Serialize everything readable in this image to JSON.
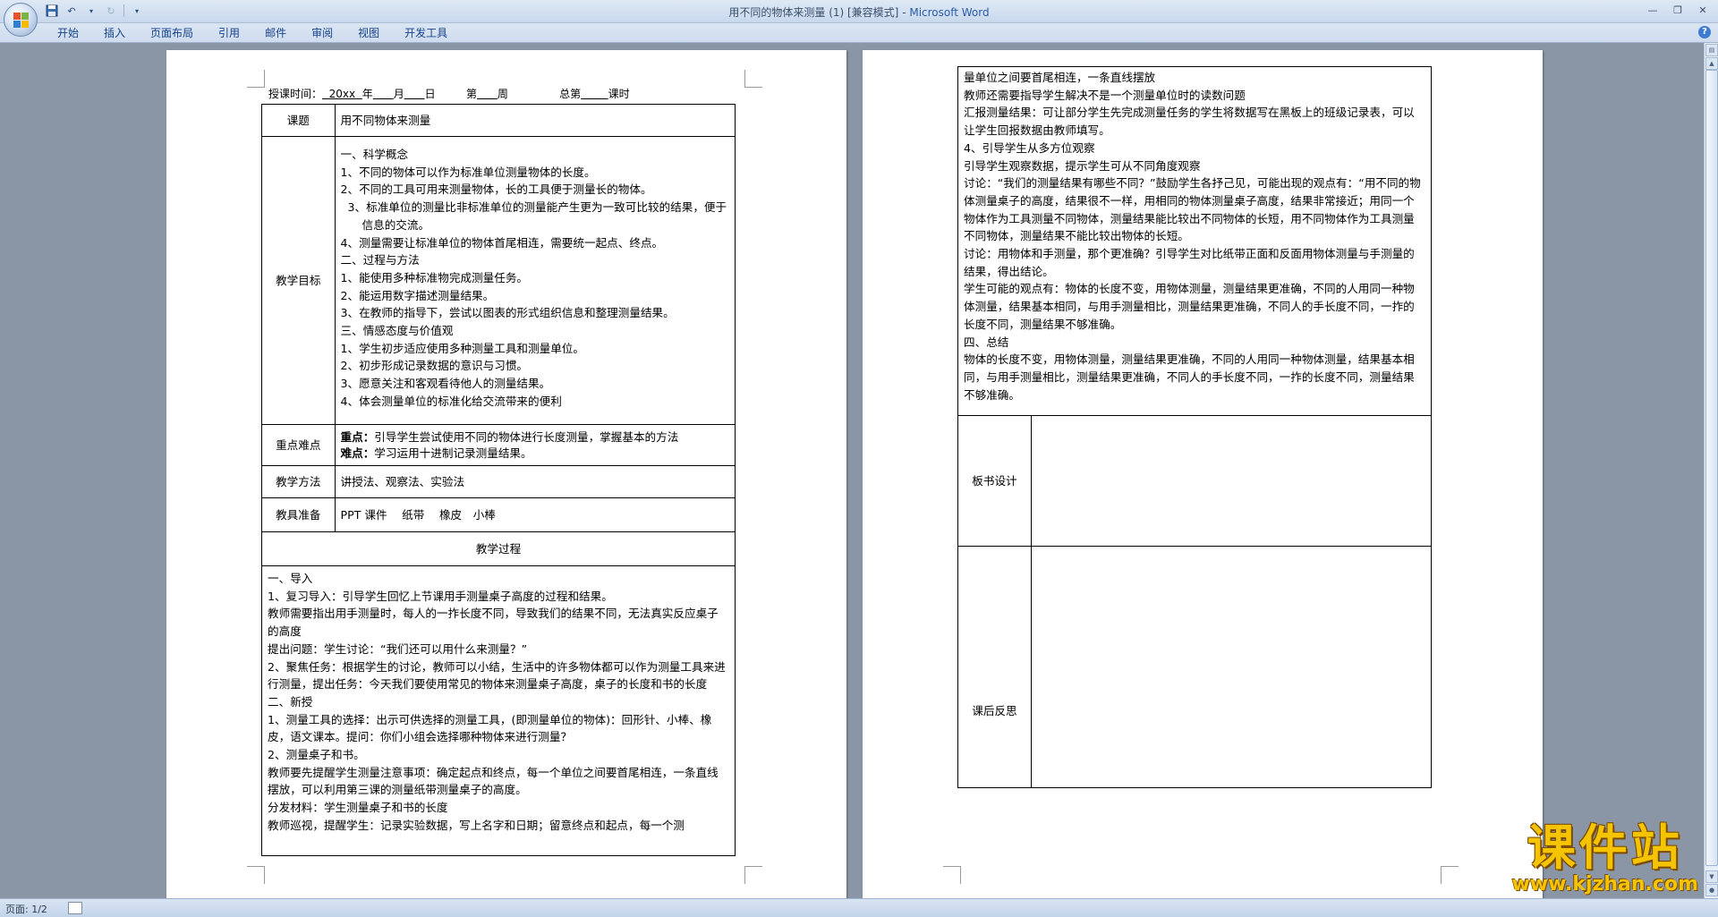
{
  "window": {
    "title": "用不同的物体来测量 (1) [兼容模式]",
    "app_name": "Microsoft Word",
    "title_sep": " - "
  },
  "ribbon": {
    "tabs": [
      "开始",
      "插入",
      "页面布局",
      "引用",
      "邮件",
      "审阅",
      "视图",
      "开发工具"
    ]
  },
  "status": {
    "page": "页面: 1/2"
  },
  "watermark": {
    "title": "课件站",
    "url": "www.kjzhan.com"
  },
  "page1": {
    "header": {
      "prefix": "授课时间：",
      "year": "20xx",
      "y": "年",
      "m": "月",
      "d": "日",
      "week_pre": "第",
      "week": "周",
      "total_pre": "总第",
      "total": "课时"
    },
    "topic_label": "课题",
    "topic": "用不同物体来测量",
    "goals_label": "教学目标",
    "goals": [
      "一、科学概念",
      "1、不同的物体可以作为标准单位测量物体的长度。",
      "2、不同的工具可用来测量物体，长的工具便于测量长的物体。",
      "3、标准单位的测量比非标准单位的测量能产生更为一致可比较的结果，便于信息的交流。",
      "4、测量需要让标准单位的物体首尾相连，需要统一起点、终点。",
      "二、过程与方法",
      "1、能使用多种标准物完成测量任务。",
      "2、能运用数字描述测量结果。",
      "3、在教师的指导下，尝试以图表的形式组织信息和整理测量结果。",
      "三、情感态度与价值观",
      "1、学生初步适应使用多种测量工具和测量单位。",
      "2、初步形成记录数据的意识与习惯。",
      "3、愿意关注和客观看待他人的测量结果。",
      "4、体会测量单位的标准化给交流带来的便利"
    ],
    "key_label": "重点难点",
    "key_point_label": "重点：",
    "key_point": "引导学生尝试使用不同的物体进行长度测量，掌握基本的方法",
    "difficulty_label": "难点：",
    "difficulty": "学习运用十进制记录测量结果。",
    "method_label": "教学方法",
    "method": "讲授法、观察法、实验法",
    "tools_label": "教具准备",
    "tools": "PPT 课件　 纸带　 橡皮　小棒",
    "process_label": "教学过程",
    "process": [
      "一、导入",
      "1、复习导入：引导学生回忆上节课用手测量桌子高度的过程和结果。",
      "教师需要指出用手测量时，每人的一拃长度不同，导致我们的结果不同，无法真实反应桌子的高度",
      "提出问题：学生讨论：“我们还可以用什么来测量？”",
      "2、聚焦任务：根据学生的讨论，教师可以小结，生活中的许多物体都可以作为测量工具来进行测量，提出任务：今天我们要使用常见的物体来测量桌子高度，桌子的长度和书的长度",
      "二、新授",
      "1、测量工具的选择：出示可供选择的测量工具，(即测量单位的物体)：回形针、小棒、橡皮，语文课本。提问：你们小组会选择哪种物体来进行测量？",
      "2、测量桌子和书。",
      "教师要先提醒学生测量注意事项：确定起点和终点，每一个单位之间要首尾相连，一条直线摆放，可以利用第三课的测量纸带测量桌子的高度。",
      "分发材料：学生测量桌子和书的长度",
      "教师巡视，提醒学生：记录实验数据，写上名字和日期；留意终点和起点，每一个测"
    ]
  },
  "page2": {
    "continued": [
      "量单位之间要首尾相连，一条直线摆放",
      "教师还需要指导学生解决不是一个测量单位时的读数问题",
      "汇报测量结果：可让部分学生先完成测量任务的学生将数据写在黑板上的班级记录表，可以让学生回报数据由教师填写。",
      "4、引导学生从多方位观察",
      "引导学生观察数据，提示学生可从不同角度观察",
      "讨论：“我们的测量结果有哪些不同？”鼓励学生各抒己见，可能出现的观点有：“用不同的物体测量桌子的高度，结果很不一样，用相同的物体测量桌子高度，结果非常接近；用同一个物体作为工具测量不同物体，测量结果能比较出不同物体的长短，用不同物体作为工具测量不同物体，测量结果不能比较出物体的长短。",
      "讨论：用物体和手测量，那个更准确？引导学生对比纸带正面和反面用物体测量与手测量的结果，得出结论。",
      "学生可能的观点有：物体的长度不变，用物体测量，测量结果更准确，不同的人用同一种物体测量，结果基本相同，与用手测量相比，测量结果更准确，不同人的手长度不同，一拃的长度不同，测量结果不够准确。",
      "四、总结",
      "物体的长度不变，用物体测量，测量结果更准确，不同的人用同一种物体测量，结果基本相同，与用手测量相比，测量结果更准确，不同人的手长度不同，一拃的长度不同，测量结果不够准确。"
    ],
    "board_label": "板书设计",
    "reflection_label": "课后反思"
  }
}
